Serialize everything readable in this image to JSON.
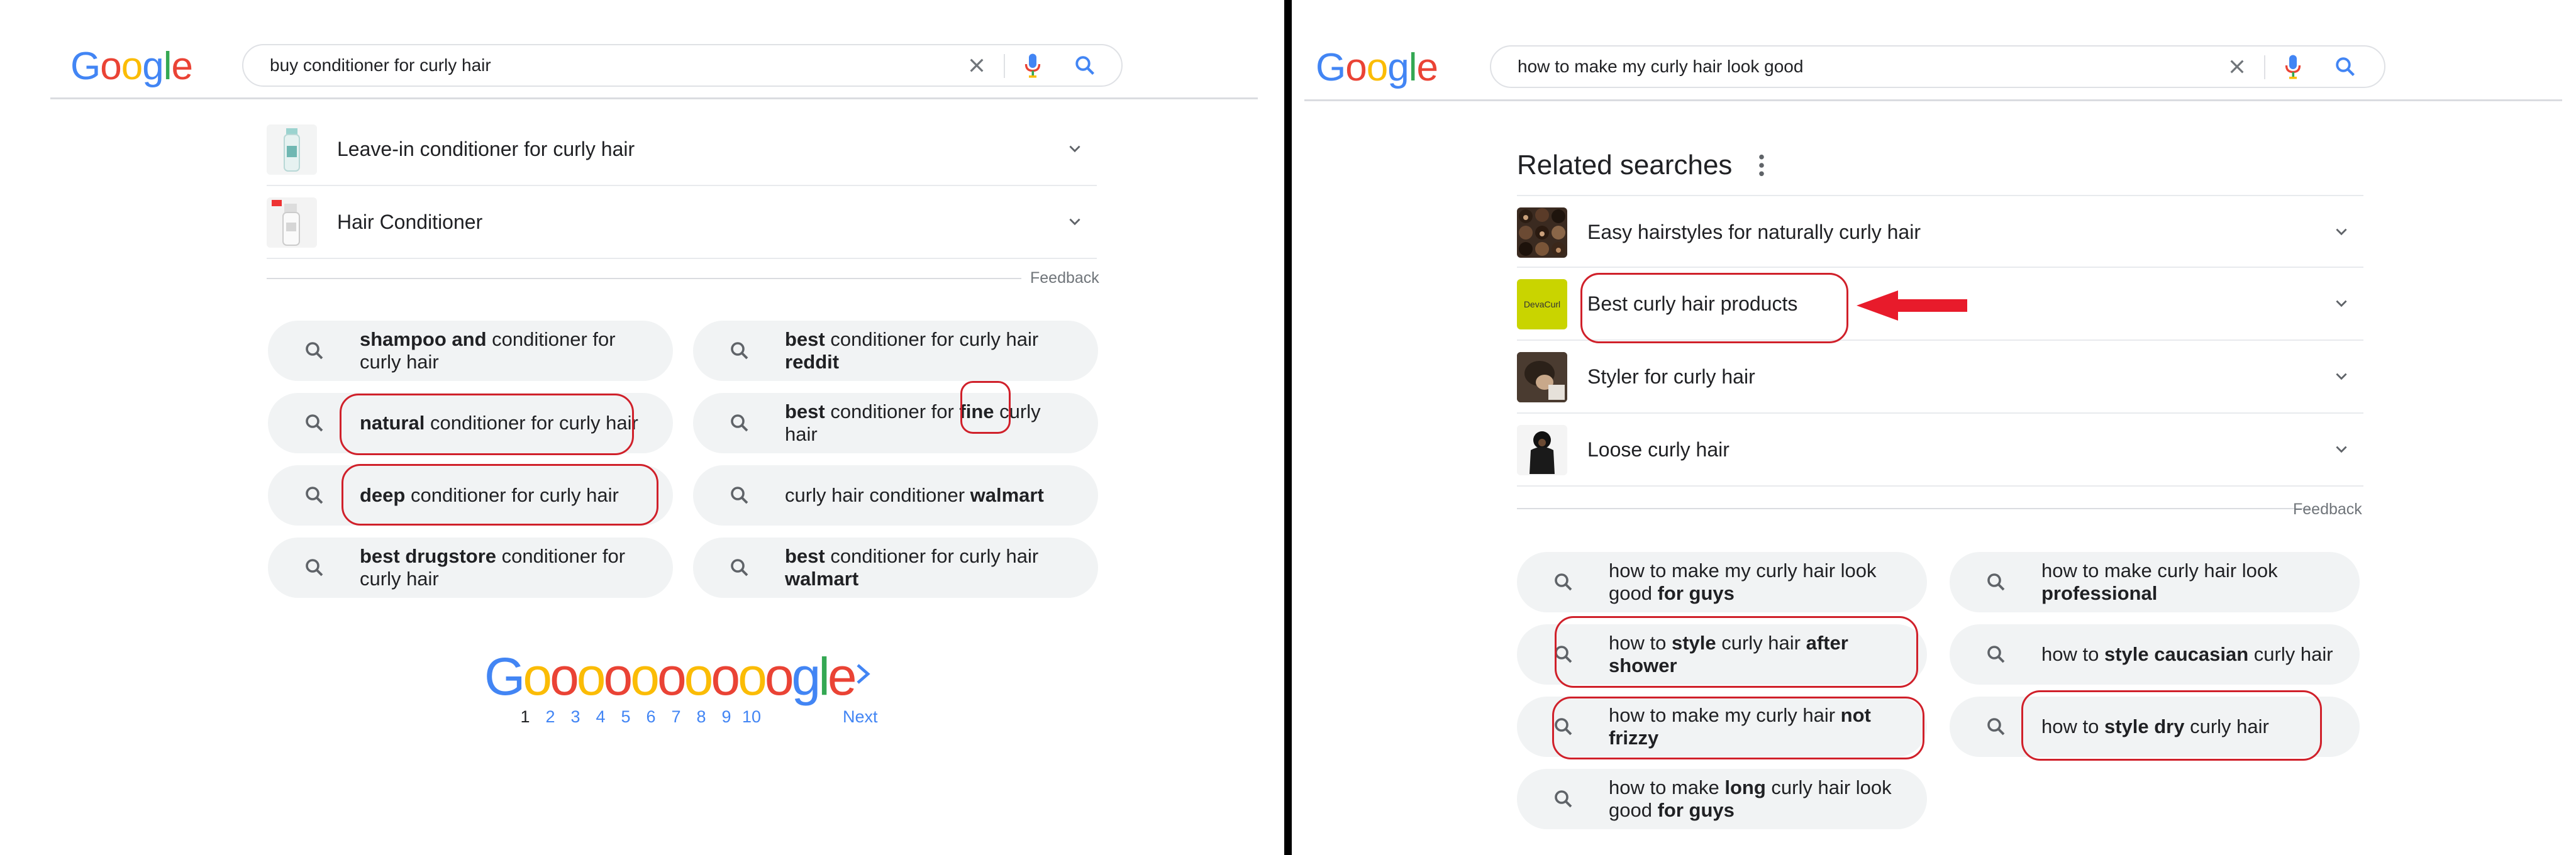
{
  "left": {
    "logo": "Google",
    "search": {
      "query": "buy conditioner for curly hair"
    },
    "related": [
      {
        "label": "Leave-in conditioner for curly hair"
      },
      {
        "label": "Hair Conditioner"
      }
    ],
    "feedback": "Feedback",
    "chips": [
      [
        {
          "b": "shampoo and"
        },
        {
          "t": " conditioner for curly hair"
        }
      ],
      [
        {
          "b": "best"
        },
        {
          "t": " conditioner for curly hair "
        },
        {
          "b": "reddit"
        }
      ],
      [
        {
          "b": "natural"
        },
        {
          "t": " conditioner for curly hair"
        }
      ],
      [
        {
          "b": "best"
        },
        {
          "t": " conditioner for "
        },
        {
          "b": "fine"
        },
        {
          "t": " curly hair"
        }
      ],
      [
        {
          "b": "deep"
        },
        {
          "t": " conditioner for curly hair"
        }
      ],
      [
        {
          "t": "curly hair conditioner "
        },
        {
          "b": "walmart"
        }
      ],
      [
        {
          "b": "best drugstore"
        },
        {
          "t": " conditioner for curly hair"
        }
      ],
      [
        {
          "b": "best"
        },
        {
          "t": " conditioner for curly hair "
        },
        {
          "b": "walmart"
        }
      ]
    ],
    "pager": {
      "logo_letters": [
        "G",
        "o",
        "o",
        "o",
        "o",
        "o",
        "o",
        "o",
        "o",
        "o",
        "o",
        "g",
        "l",
        "e"
      ],
      "pages": [
        "1",
        "2",
        "3",
        "4",
        "5",
        "6",
        "7",
        "8",
        "9",
        "10"
      ],
      "current": "1",
      "next": "Next"
    }
  },
  "right": {
    "logo": "Google",
    "search": {
      "query": "how to make my curly hair look good"
    },
    "related_title": "Related searches",
    "related": [
      {
        "label": "Easy hairstyles for naturally curly hair"
      },
      {
        "label": "Best curly hair products",
        "thumb_text": "DevaCurl"
      },
      {
        "label": "Styler for curly hair"
      },
      {
        "label": "Loose curly hair"
      }
    ],
    "feedback": "Feedback",
    "chips": [
      [
        {
          "t": "how to make my curly hair look good "
        },
        {
          "b": "for guys"
        }
      ],
      [
        {
          "t": "how to make curly hair look "
        },
        {
          "b": "professional"
        }
      ],
      [
        {
          "t": "how to "
        },
        {
          "b": "style"
        },
        {
          "t": " curly hair "
        },
        {
          "b": "after shower"
        }
      ],
      [
        {
          "t": "how to "
        },
        {
          "b": "style caucasian"
        },
        {
          "t": " curly hair"
        }
      ],
      [
        {
          "t": "how to make my curly hair "
        },
        {
          "b": "not frizzy"
        }
      ],
      [
        {
          "t": "how to "
        },
        {
          "b": "style dry"
        },
        {
          "t": " curly hair"
        }
      ],
      [
        {
          "t": "how to make "
        },
        {
          "b": "long"
        },
        {
          "t": " curly hair look good "
        },
        {
          "b": "for guys"
        }
      ]
    ]
  },
  "colors": {
    "google_blue": "#4285f4",
    "google_red": "#ea4335",
    "google_yellow": "#fbbc05",
    "google_green": "#34a853",
    "chip_bg": "#f1f3f4",
    "annotation_red": "#d0202a",
    "divider": "#000000"
  },
  "icons": [
    "clear-icon",
    "mic-icon",
    "search-icon",
    "chevron-down-icon",
    "more-vert-icon",
    "chevron-right-icon",
    "red-arrow-annotation"
  ]
}
